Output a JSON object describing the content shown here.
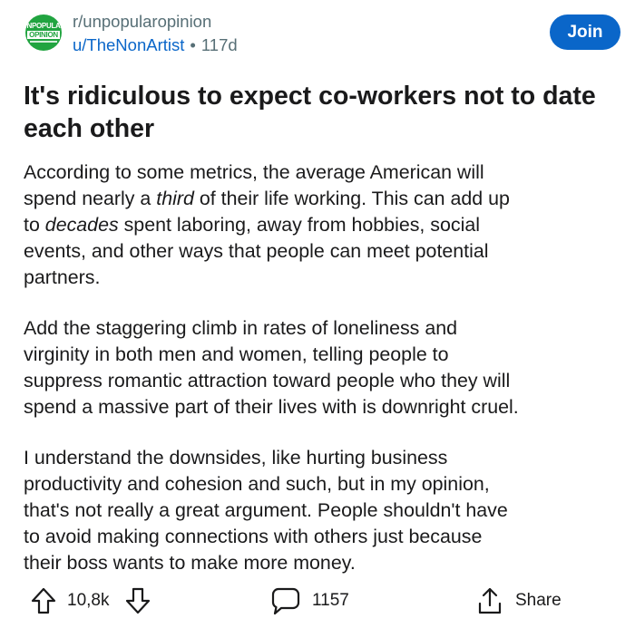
{
  "header": {
    "avatar_line1": "UNPOPULAR",
    "avatar_line2": "OPINION",
    "subreddit": "r/unpopularopinion",
    "username": "u/TheNonArtist",
    "separator": "•",
    "age": "117d",
    "join_label": "Join"
  },
  "post": {
    "title": "It's ridiculous to expect co-workers not to date each other",
    "p1": [
      "According to some metrics, the average American will",
      [
        "spend nearly a ",
        "third",
        " of their life working. This can add up"
      ],
      [
        "to ",
        "decades",
        " spent laboring, away from hobbies, social"
      ],
      "events, and other ways that people can meet potential",
      "partners."
    ],
    "p2": [
      "Add the staggering climb in rates of loneliness and",
      "virginity in both men and women, telling people to",
      "suppress romantic attraction toward people who they will",
      "spend a massive part of their lives with is downright cruel."
    ],
    "p3": [
      "I understand the downsides, like hurting business",
      "productivity and cohesion and such, but in my opinion,",
      "that's not really a great argument. People shouldn't have",
      "to avoid making connections with others just because",
      "their boss wants to make more money."
    ]
  },
  "actions": {
    "votes": "10,8k",
    "comments": "1157",
    "share_label": "Share",
    "icons": [
      "upvote-icon",
      "downvote-icon",
      "comment-icon",
      "share-icon"
    ]
  },
  "colors": {
    "brand_green": "#21a440",
    "link_blue": "#0a66c9",
    "meta_gray": "#576f76",
    "text": "#1a1a1b"
  }
}
